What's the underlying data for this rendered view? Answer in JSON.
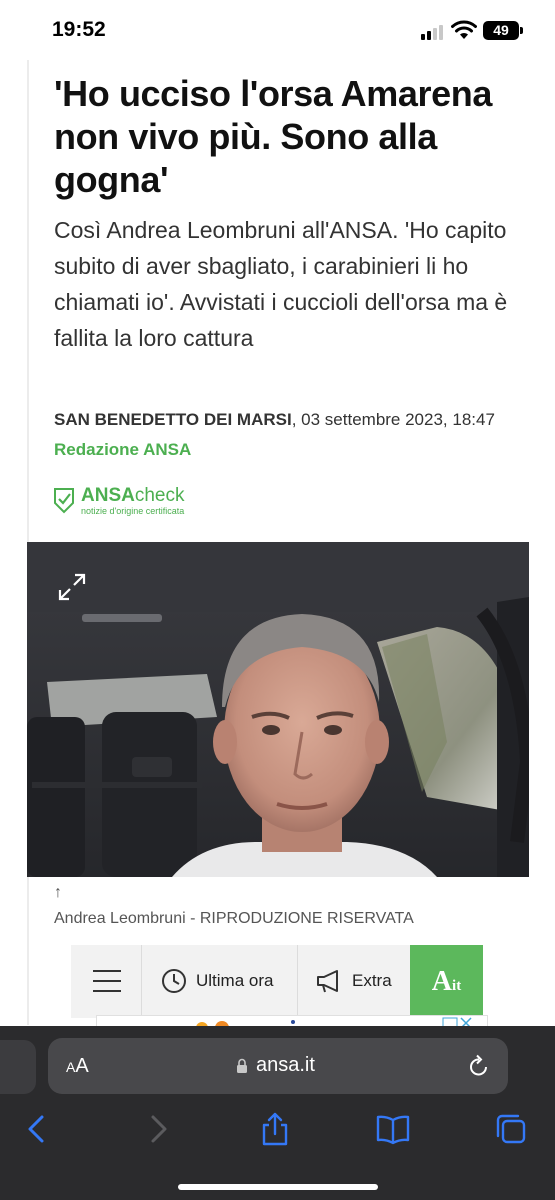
{
  "status_bar": {
    "time": "19:52",
    "battery": "49"
  },
  "article": {
    "headline": "'Ho ucciso l'orsa Amarena non vivo più. Sono alla gogna'",
    "subheadline": "Così Andrea Leombruni all'ANSA. 'Ho capito subito di aver sbagliato, i carabinieri li ho chiamati io'. Avvistati i cuccioli dell'orsa ma è fallita la loro cattura",
    "dateline_location": "SAN BENEDETTO DEI MARSI",
    "dateline_date": ", 03 settembre 2023, 18:47",
    "author": "Redazione ANSA",
    "ansa_check": {
      "brand_bold": "ANSA",
      "brand_light": "check",
      "tagline": "notizie d'origine certificata"
    },
    "photo": {
      "caption_arrow": "↑",
      "caption": "Andrea Leombruni - RIPRODUZIONE RISERVATA"
    }
  },
  "site_nav": {
    "ultima_ora": "Ultima ora",
    "extra": "Extra",
    "ait_big": "A",
    "ait_small": "it"
  },
  "browser": {
    "aa_small": "A",
    "aa_big": "A",
    "url": "ansa.it"
  },
  "colors": {
    "ansa_green": "#4caf50",
    "safari_bar": "#2b2b2d",
    "safari_accent": "#3478f6"
  },
  "icons": [
    "expand-icon",
    "menu-icon",
    "clock-icon",
    "megaphone-icon",
    "lock-icon",
    "reload-icon",
    "back-icon",
    "forward-icon",
    "share-icon",
    "bookmarks-icon",
    "tabs-icon"
  ]
}
